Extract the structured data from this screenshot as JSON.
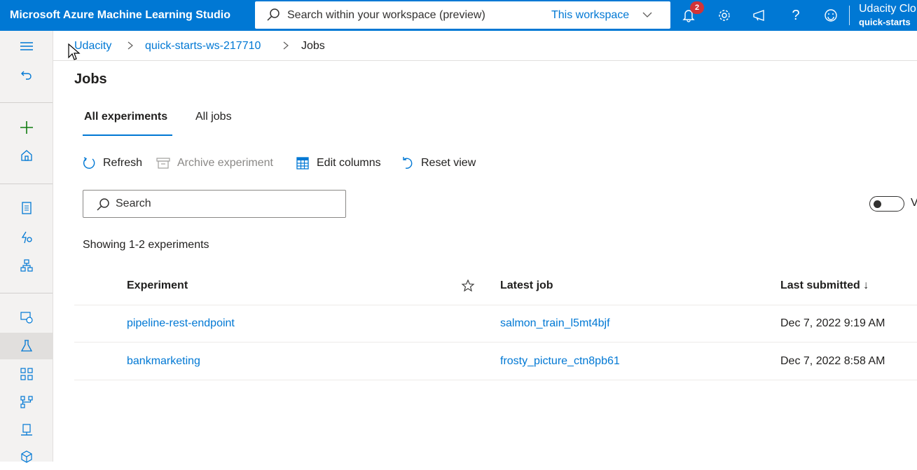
{
  "app": {
    "title": "Microsoft Azure Machine Learning Studio"
  },
  "topbar": {
    "search_placeholder": "Search within your workspace (preview)",
    "scope_label": "This workspace",
    "notification_count": "2",
    "user_name": "Udacity Clo",
    "workspace_name": "quick-starts"
  },
  "breadcrumb": {
    "items": [
      "Udacity",
      "quick-starts-ws-217710",
      "Jobs"
    ]
  },
  "page": {
    "title": "Jobs"
  },
  "tabs": [
    {
      "label": "All experiments",
      "active": true
    },
    {
      "label": "All jobs",
      "active": false
    }
  ],
  "toolbar": {
    "refresh": "Refresh",
    "archive": "Archive experiment",
    "edit_columns": "Edit columns",
    "reset_view": "Reset view"
  },
  "filter": {
    "search_placeholder": "Search",
    "toggle_label": "V"
  },
  "summary": {
    "showing": "Showing 1-2 experiments"
  },
  "table": {
    "headers": {
      "experiment": "Experiment",
      "latest_job": "Latest job",
      "last_submitted": "Last submitted ↓"
    },
    "rows": [
      {
        "experiment": "pipeline-rest-endpoint",
        "latest_job": "salmon_train_l5mt4bjf",
        "last_submitted": "Dec 7, 2022 9:19 AM"
      },
      {
        "experiment": "bankmarketing",
        "latest_job": "frosty_picture_ctn8pb61",
        "last_submitted": "Dec 7, 2022 8:58 AM"
      }
    ]
  },
  "colors": {
    "accent": "#0078d4",
    "badge": "#d13438",
    "add_icon": "#107c10"
  },
  "icons": [
    "search-icon",
    "chevron-down-icon",
    "bell-icon",
    "gear-icon",
    "megaphone-icon",
    "help-icon",
    "smiley-icon",
    "hamburger-icon",
    "back-icon",
    "plus-icon",
    "home-icon",
    "notebook-icon",
    "automl-icon",
    "designer-icon",
    "data-icon",
    "experiment-icon",
    "pipeline-icon",
    "models-icon",
    "endpoints-icon",
    "compute-icon",
    "environment-icon",
    "refresh-icon",
    "archive-icon",
    "edit-columns-icon",
    "reset-view-icon",
    "star-icon"
  ]
}
